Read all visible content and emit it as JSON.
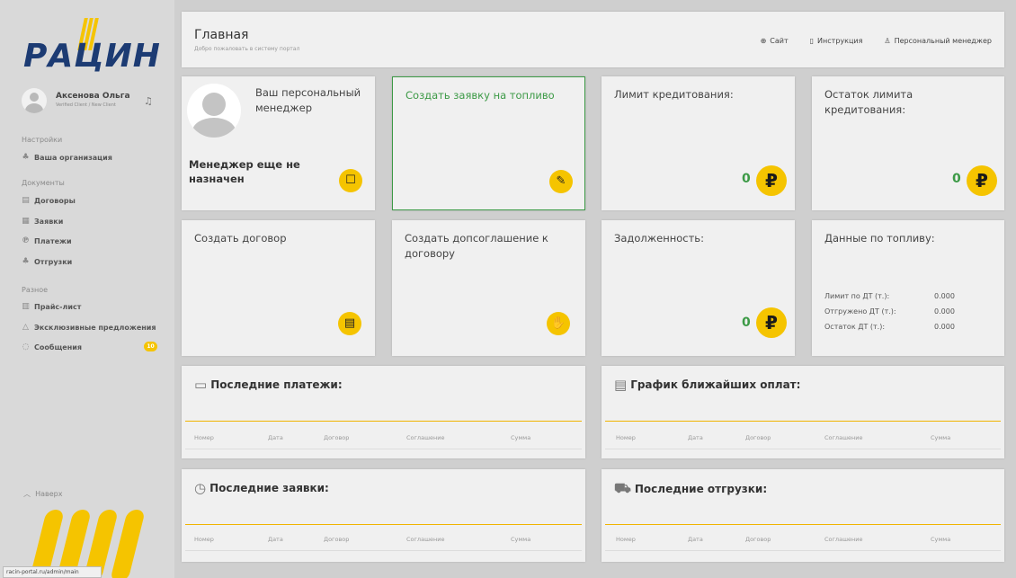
{
  "sidebar": {
    "logo_text": "РАЦИН",
    "user": {
      "name": "Аксенова Ольга",
      "status": "Verified Client / New Client"
    },
    "sections": {
      "settings": "Настройки",
      "documents": "Документы",
      "misc": "Разное"
    },
    "items": {
      "organization": "Ваша организация",
      "contracts": "Договоры",
      "orders": "Заявки",
      "payments": "Платежи",
      "shipments": "Отгрузки",
      "price_list": "Прайс-лист",
      "exclusive": "Эксклюзивные предложения",
      "messages": "Сообщения"
    },
    "messages_badge": "10",
    "back_to_top": "Наверх",
    "url_tooltip": "racin-portal.ru/admin/main"
  },
  "header": {
    "title": "Главная",
    "subtitle": "Добро пожаловать в систему портал",
    "links": {
      "site": "Сайт",
      "instruction": "Инструкция",
      "manager": "Персональный менеджер"
    }
  },
  "tiles": {
    "manager_title": "Ваш персональный менеджер",
    "manager_status": "Менеджер еще не назначен",
    "create_fuel_order": "Создать заявку на топливо",
    "credit_limit": "Лимит кредитования:",
    "credit_limit_value": "0",
    "credit_remainder": "Остаток лимита кредитования:",
    "credit_remainder_value": "0",
    "create_contract": "Создать договор",
    "create_addendum": "Создать допсоглашение к договору",
    "debt": "Задолженность:",
    "debt_value": "0",
    "fuel_data": "Данные по топливу:",
    "fuel_rows": [
      {
        "label": "Лимит по ДТ (т.):",
        "value": "0.000"
      },
      {
        "label": "Отгружено ДТ (т.):",
        "value": "0.000"
      },
      {
        "label": "Остаток ДТ (т.):",
        "value": "0.000"
      }
    ]
  },
  "lists": {
    "payments": {
      "title": "Последние платежи:",
      "columns": [
        "Номер",
        "Дата",
        "Договор",
        "Соглашение",
        "Сумма"
      ]
    },
    "schedule": {
      "title": "График ближайших оплат:",
      "columns": [
        "Номер",
        "Дата",
        "Договор",
        "Соглашение",
        "Сумма"
      ]
    },
    "orders": {
      "title": "Последние заявки:",
      "columns": [
        "Номер",
        "Дата",
        "Договор",
        "Соглашение",
        "Сумма"
      ]
    },
    "shipments": {
      "title": "Последние отгрузки:",
      "columns": [
        "Номер",
        "Дата",
        "Договор",
        "Соглашение",
        "Сумма"
      ]
    }
  },
  "colors": {
    "accent_yellow": "#f5c400",
    "brand_blue": "#1c3b73",
    "green": "#3c9a46"
  }
}
